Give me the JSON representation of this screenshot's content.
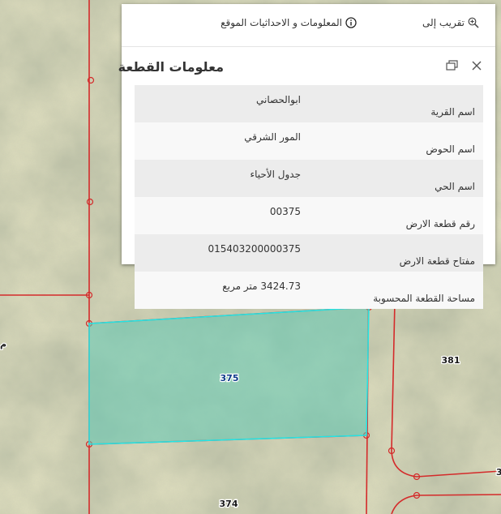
{
  "toolbar": {
    "location_info_label": "المعلومات و الاحداثيات الموقع",
    "zoom_to_label": "تقريب إلى"
  },
  "popup": {
    "title": "معلومات القطعة",
    "rows": [
      {
        "label": "اسم القرية",
        "value": "ابوالحصاني"
      },
      {
        "label": "اسم الحوض",
        "value": "المور الشرقي"
      },
      {
        "label": "اسم الحي",
        "value": "جدول الأحياء"
      },
      {
        "label": "رقم قطعة الارض",
        "value": "00375"
      },
      {
        "label": "مفتاح قطعة الارض",
        "value": "015403200000375"
      },
      {
        "label": "مساحة القطعة المحسوبة",
        "value": "3424.73 متر مربع"
      }
    ]
  },
  "map": {
    "parcel_labels": {
      "selected": "375",
      "east": "381",
      "south": "374",
      "edge_right": "3",
      "edge_left": "م"
    },
    "colors": {
      "parcel_line": "#d42a2a",
      "selection_fill": "#5ec8b4",
      "selection_stroke": "#22e6e6"
    }
  }
}
